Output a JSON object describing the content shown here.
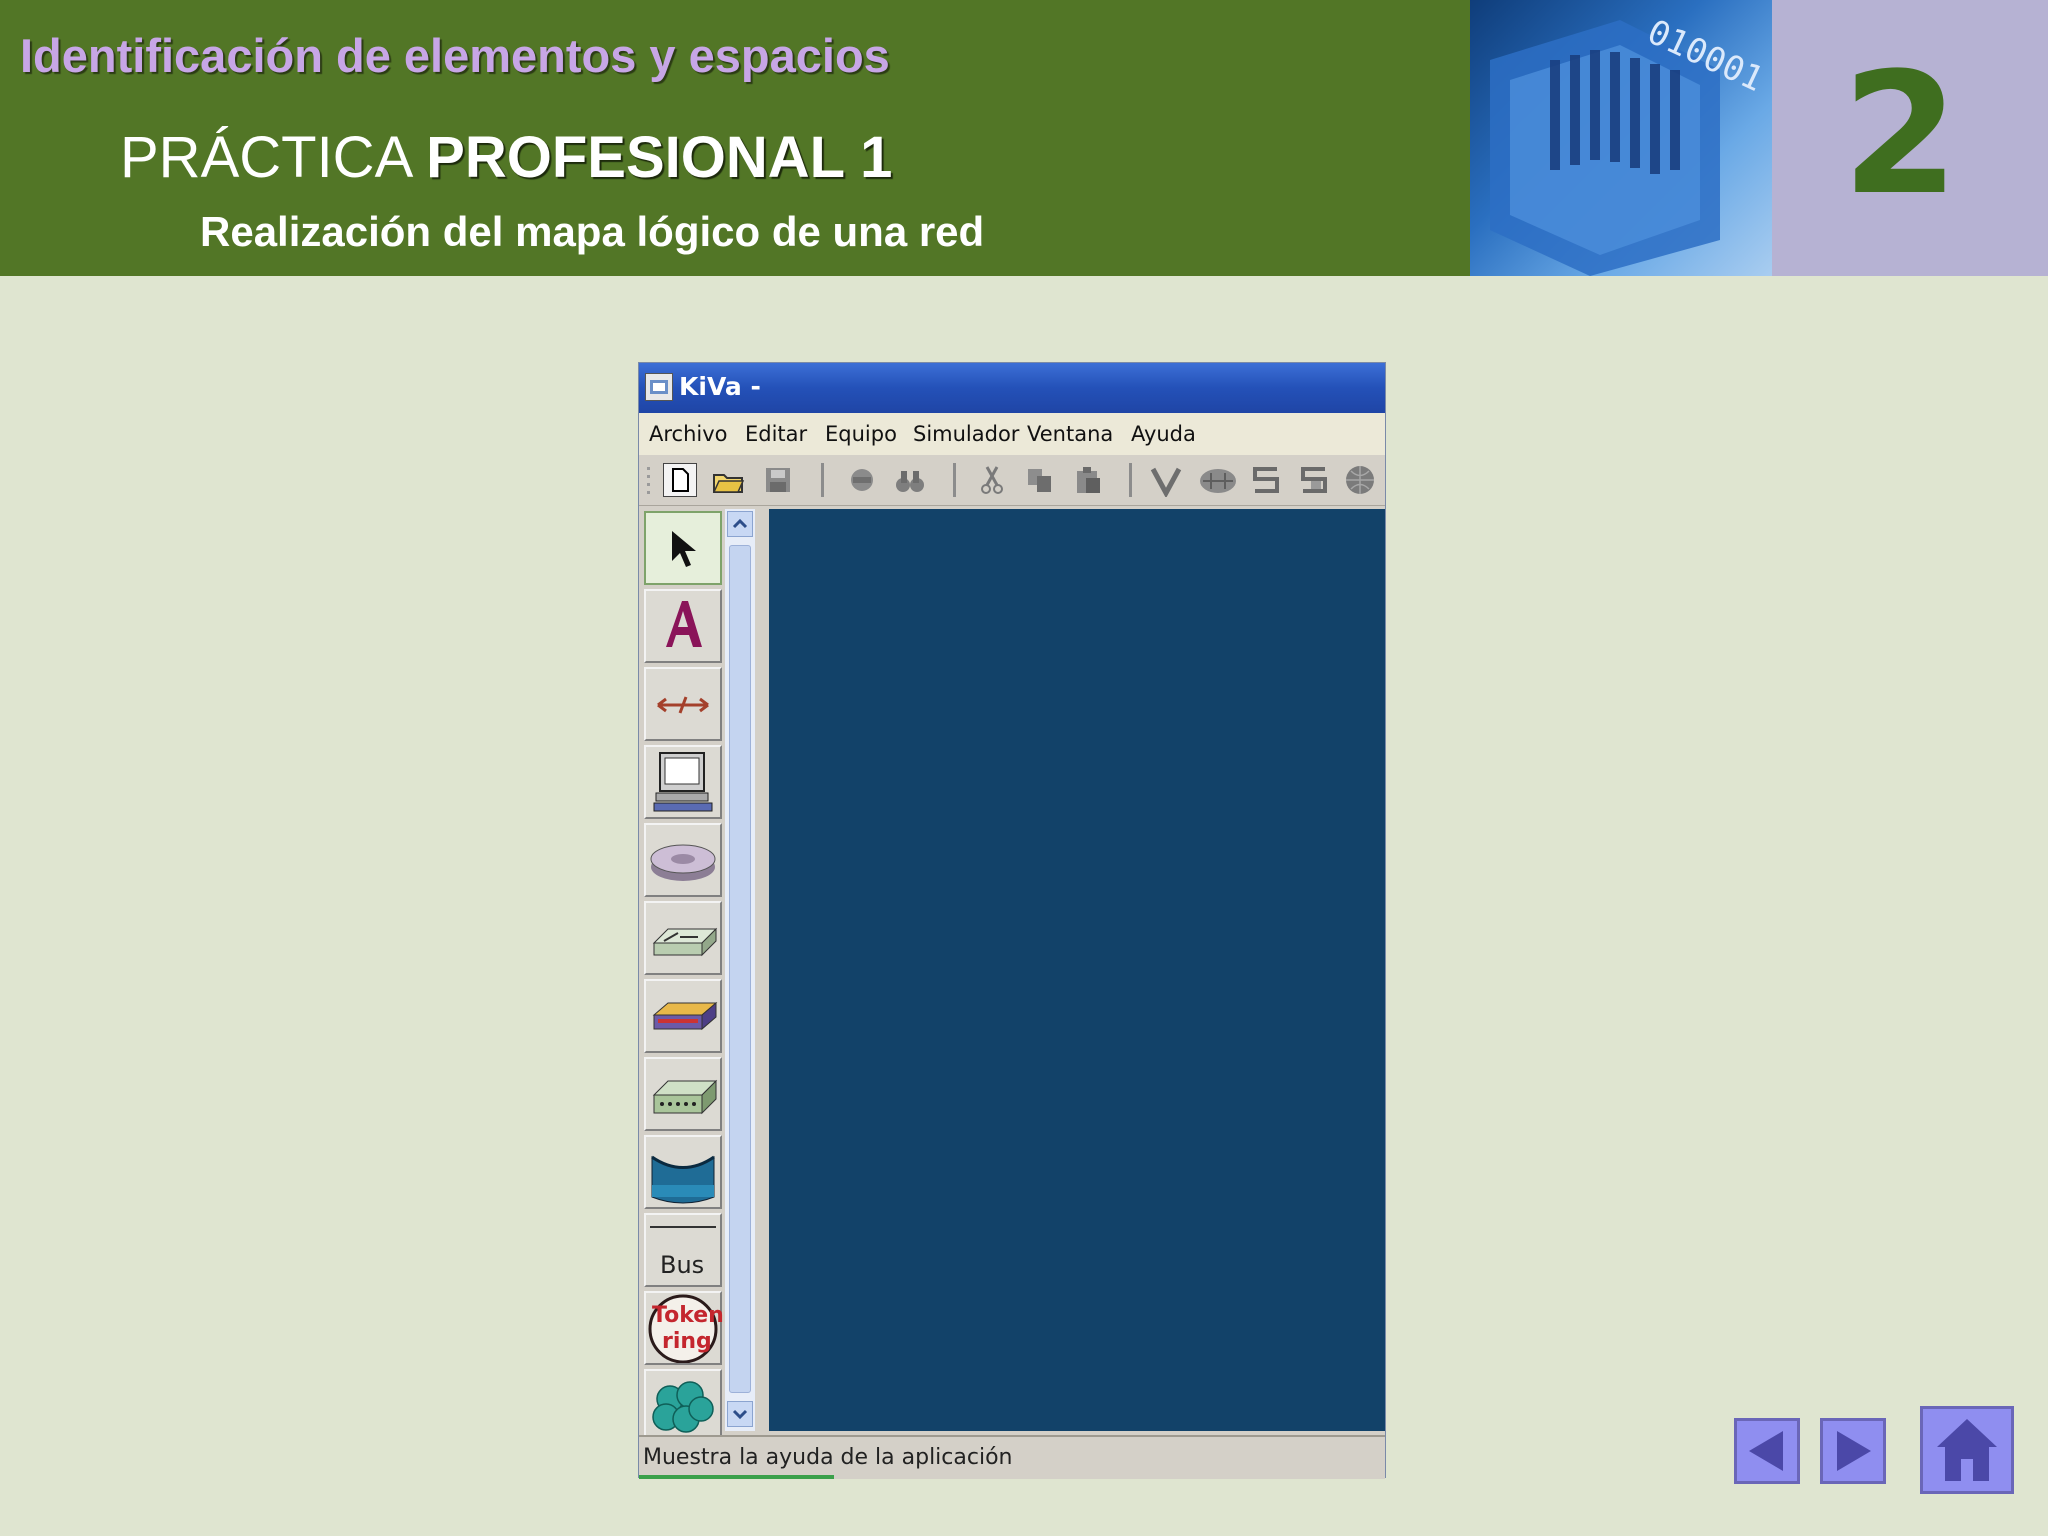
{
  "header": {
    "kicker": "Identificación de elementos y espacios",
    "title_regular": "PRÁCTICA ",
    "title_bold": "PROFESIONAL 1",
    "subtitle": "Realización del mapa lógico de una red",
    "unit_number": "2"
  },
  "window": {
    "title": "KiVa -",
    "menu": [
      "Archivo",
      "Editar",
      "Equipo",
      "Simulador",
      "Ventana",
      "Ayuda"
    ],
    "toolbar_icons": [
      "new-file-icon",
      "open-folder-icon",
      "save-icon",
      "tool-icon",
      "binoculars-icon",
      "cut-icon",
      "copy-icon",
      "paste-icon",
      "v-icon",
      "route-icon",
      "s-icon",
      "s-window-icon",
      "globe-icon"
    ],
    "palette": {
      "bus_label": "Bus",
      "token_ring_label_1": "Token",
      "token_ring_label_2": "ring",
      "tools": [
        "pointer",
        "text",
        "link",
        "computer",
        "hub",
        "switch",
        "router",
        "modem",
        "wireless",
        "bus",
        "token-ring",
        "cloud"
      ]
    },
    "status_text": "Muestra la ayuda de la aplicación"
  },
  "nav": {
    "prev": "previous",
    "next": "next",
    "home": "home"
  },
  "colors": {
    "header_green": "#527626",
    "kicker_lavender": "#c7a6e6",
    "number_green": "#3f6e1f",
    "number_panel": "#b6b2d3",
    "background": "#dfe5d0",
    "canvas_blue": "#124269",
    "nav_button": "#8f8ef0"
  }
}
